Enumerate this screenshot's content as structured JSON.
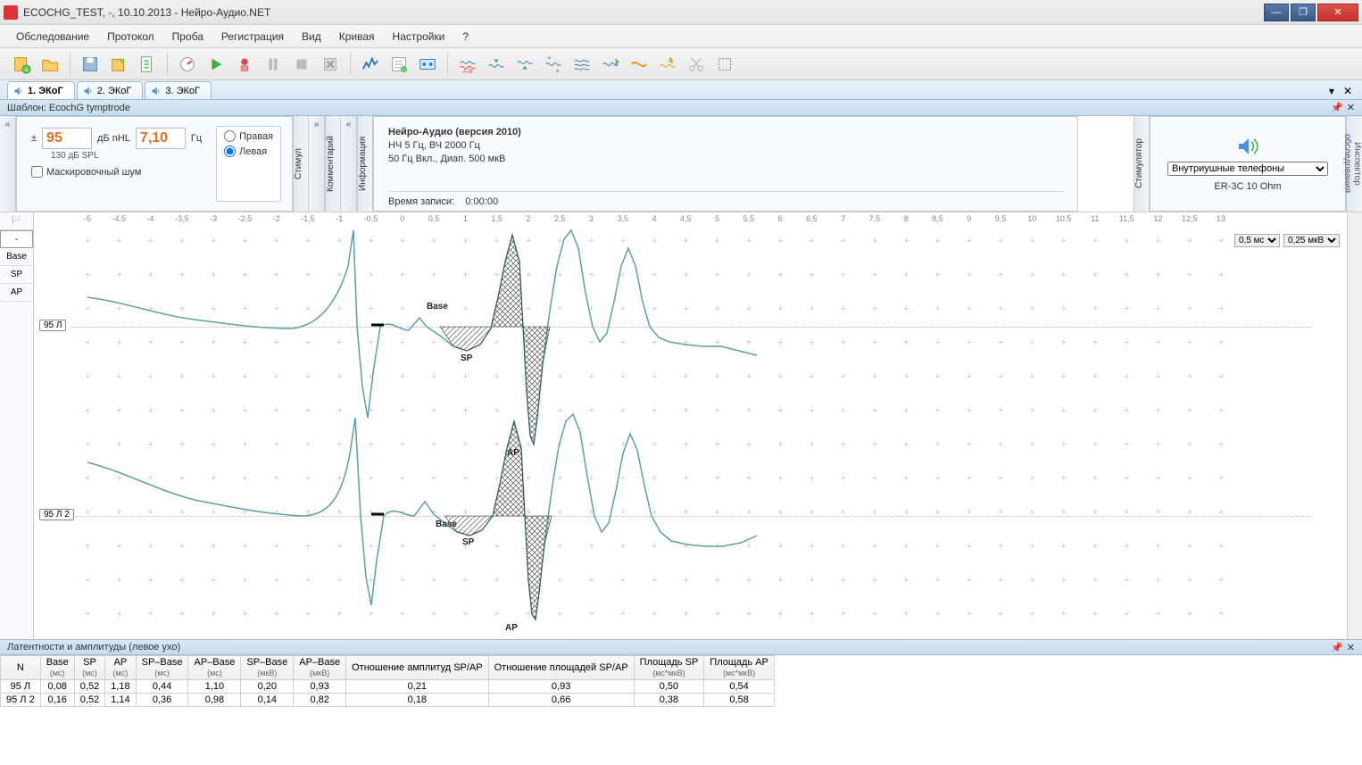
{
  "window": {
    "title": "ECOCHG_TEST, -, 10.10.2013 - Нейро-Аудио.NET"
  },
  "menu": [
    "Обследование",
    "Протокол",
    "Проба",
    "Регистрация",
    "Вид",
    "Кривая",
    "Настройки",
    "?"
  ],
  "tabs": [
    {
      "label": "1. ЭКоГ",
      "active": true
    },
    {
      "label": "2. ЭКоГ",
      "active": false
    },
    {
      "label": "3. ЭКоГ",
      "active": false
    }
  ],
  "template_bar": {
    "label": "Шаблон: EcochG tymptrode"
  },
  "stim_panel": {
    "pm": "±",
    "intensity": "95",
    "intensity_unit": "дБ nHL",
    "sub": "130 дБ SPL",
    "rate": "7,10",
    "rate_unit": "Гц",
    "mask_label": "Маскировочный шум",
    "side_right": "Правая",
    "side_left": "Левая",
    "vlabel": "Стимул",
    "comment_vlabel": "Комментарий"
  },
  "info_panel": {
    "vlabel": "Информация",
    "line1": "Нейро-Аудио (версия 2010)",
    "line2": "НЧ  5 Гц, ВЧ  2000 Гц",
    "line3": "50 Гц  Вкл., Диап. 500 мкВ",
    "rec_label": "Время записи:",
    "rec_value": "0:00:00"
  },
  "stimr_panel": {
    "vlabel": "Стимулятор",
    "select": "Внутриушные телефоны",
    "model": "ER-3C 10 Ohm"
  },
  "right_strip": "Инспектор обследования",
  "wave": {
    "leftcol": [
      "-",
      "Base",
      "SP",
      "AP"
    ],
    "trace_labels": [
      "95 Л",
      "95 Л 2"
    ],
    "scale_x": "0,5 мс",
    "scale_y": "0,25 мкВ",
    "markers": {
      "base": "Base",
      "sp": "SP",
      "ap": "AP"
    }
  },
  "chart_data": {
    "type": "line",
    "xlabel": "мс",
    "ylabel": "мкВ",
    "x_ticks": [
      "-5",
      "-4,5",
      "-4",
      "-3,5",
      "-3",
      "-2,5",
      "-2",
      "-1,5",
      "-1",
      "-0,5",
      "0",
      "0,5",
      "1",
      "1,5",
      "2",
      "2,5",
      "3",
      "3,5",
      "4",
      "4,5",
      "5",
      "5,5",
      "6",
      "6,5",
      "7",
      "7,5",
      "8",
      "8,5",
      "9",
      "9,5",
      "10",
      "10,5",
      "11",
      "11,5",
      "12",
      "12,5",
      "13"
    ],
    "x_range_ms": [
      -5,
      13
    ],
    "x_scale_step_ms": 0.5,
    "y_scale_step_uv": 0.25,
    "series": [
      {
        "name": "95 Л",
        "markers": {
          "Base": {
            "t_ms": 0.08
          },
          "SP": {
            "t_ms": 0.52
          },
          "AP": {
            "t_ms": 1.18
          }
        },
        "amplitudes_uv": {
          "SP_Base": 0.2,
          "AP_Base": 0.93
        },
        "latency_diff_ms": {
          "SP_Base": 0.44,
          "AP_Base": 1.1
        },
        "ratio_amp_SP_AP": 0.21,
        "ratio_area_SP_AP": 0.93,
        "area_SP_ms_uv": 0.5,
        "area_AP_ms_uv": 0.54
      },
      {
        "name": "95 Л 2",
        "markers": {
          "Base": {
            "t_ms": 0.16
          },
          "SP": {
            "t_ms": 0.52
          },
          "AP": {
            "t_ms": 1.14
          }
        },
        "amplitudes_uv": {
          "SP_Base": 0.14,
          "AP_Base": 0.82
        },
        "latency_diff_ms": {
          "SP_Base": 0.36,
          "AP_Base": 0.98
        },
        "ratio_amp_SP_AP": 0.18,
        "ratio_area_SP_AP": 0.66,
        "area_SP_ms_uv": 0.38,
        "area_AP_ms_uv": 0.58
      }
    ]
  },
  "bottom": {
    "title": "Латентности и амплитуды (левое ухо)",
    "columns": [
      "N",
      "Base",
      "SP",
      "AP",
      "SP–Base",
      "AP–Base",
      "SP–Base",
      "AP–Base",
      "Отношение амплитуд SP/AP",
      "Отношение площадей SP/AP",
      "Площадь SP",
      "Площадь AP"
    ],
    "units": [
      "",
      "(мс)",
      "(мс)",
      "(мс)",
      "(мс)",
      "(мс)",
      "(мкВ)",
      "(мкВ)",
      "",
      "",
      "(мс*мкВ)",
      "(мс*мкВ)"
    ],
    "rows": [
      [
        "95 Л",
        "0,08",
        "0,52",
        "1,18",
        "0,44",
        "1,10",
        "0,20",
        "0,93",
        "0,21",
        "0,93",
        "0,50",
        "0,54"
      ],
      [
        "95 Л 2",
        "0,16",
        "0,52",
        "1,14",
        "0,36",
        "0,98",
        "0,14",
        "0,82",
        "0,18",
        "0,66",
        "0,38",
        "0,58"
      ]
    ]
  }
}
